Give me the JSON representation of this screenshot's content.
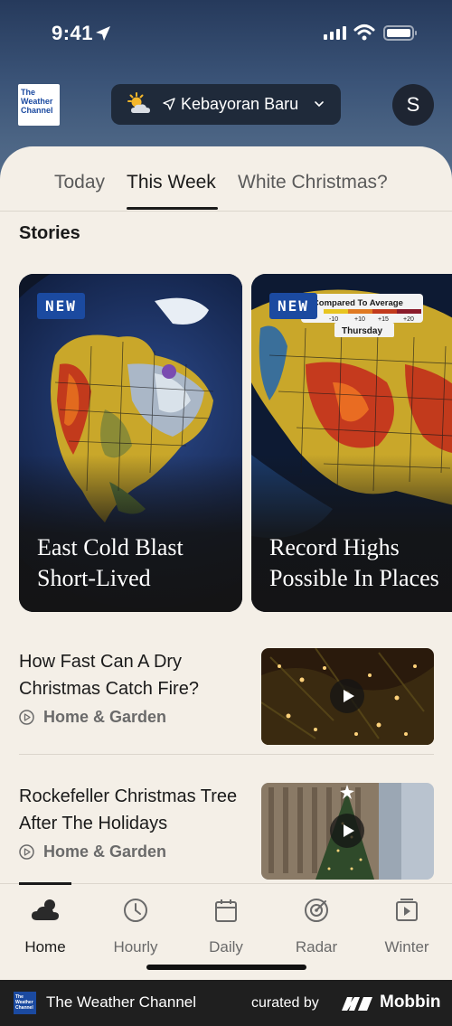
{
  "status": {
    "time": "9:41"
  },
  "header": {
    "logo_lines": [
      "The",
      "Weather",
      "Channel"
    ],
    "location": "Kebayoran Baru",
    "avatar_initial": "S"
  },
  "tabs": [
    {
      "label": "Today",
      "active": false
    },
    {
      "label": "This Week",
      "active": true
    },
    {
      "label": "White Christmas?",
      "active": false
    }
  ],
  "stories_section": {
    "title": "Stories"
  },
  "featured_cards": [
    {
      "badge": "NEW",
      "title": "East Cold Blast Short-Lived"
    },
    {
      "badge": "NEW",
      "title": "Record Highs Possible In Places",
      "map_legend": "s Compared To Average",
      "map_legend_values": [
        "-10",
        "+10",
        "+15",
        "+20"
      ],
      "map_day": "Thursday"
    }
  ],
  "stories": [
    {
      "title": "How Fast Can A Dry Christmas Catch Fire?",
      "category": "Home & Garden"
    },
    {
      "title": "Rockefeller Christmas Tree After The Holidays",
      "category": "Home & Garden"
    }
  ],
  "tabbar": [
    {
      "label": "Home",
      "icon": "home-cloud-icon",
      "active": true
    },
    {
      "label": "Hourly",
      "icon": "clock-icon",
      "active": false
    },
    {
      "label": "Daily",
      "icon": "calendar-icon",
      "active": false
    },
    {
      "label": "Radar",
      "icon": "radar-icon",
      "active": false
    },
    {
      "label": "Winter",
      "icon": "winter-video-icon",
      "active": false
    }
  ],
  "footer": {
    "logo_lines": [
      "The",
      "Weather",
      "Channel"
    ],
    "brand": "The Weather Channel",
    "curated_by": "curated by",
    "mobbin": "Mobbin"
  },
  "colors": {
    "brand_blue": "#1b4aa0",
    "sheet_bg": "#f4efe7",
    "header_bg": "#2a3d5e"
  }
}
